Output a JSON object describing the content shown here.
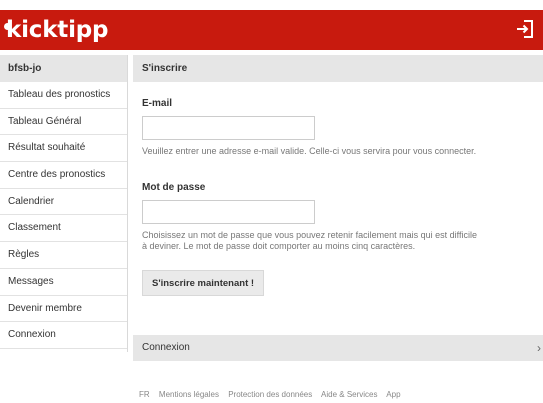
{
  "header": {
    "logo_text": "kicktipp",
    "brand_color": "#c81a0e",
    "login_icon": "login-arrow-icon"
  },
  "sidebar": {
    "group_label": "bfsb-jo",
    "items": [
      {
        "label": "Tableau des pronostics"
      },
      {
        "label": "Tableau Général"
      },
      {
        "label": "Résultat souhaité"
      },
      {
        "label": "Centre des pronostics"
      },
      {
        "label": "Calendrier"
      },
      {
        "label": "Classement"
      },
      {
        "label": "Règles"
      },
      {
        "label": "Messages"
      },
      {
        "label": "Devenir membre"
      },
      {
        "label": "Connexion"
      }
    ]
  },
  "main": {
    "section_title": "S'inscrire",
    "email": {
      "label": "E-mail",
      "value": "",
      "hint": "Veuillez entrer une adresse e-mail valide. Celle-ci vous servira pour vous connecter."
    },
    "password": {
      "label": "Mot de passe",
      "value": "",
      "hint": "Choisissez un mot de passe que vous pouvez retenir facilement mais qui est difficile à deviner. Le mot de passe doit comporter au moins cinq caractères."
    },
    "submit_label": "S'inscrire maintenant !",
    "connexion_bar": {
      "label": "Connexion",
      "chevron": "›"
    }
  },
  "footer": {
    "links": [
      "FR",
      "Mentions légales",
      "Protection des données",
      "Aide & Services",
      "App"
    ]
  }
}
